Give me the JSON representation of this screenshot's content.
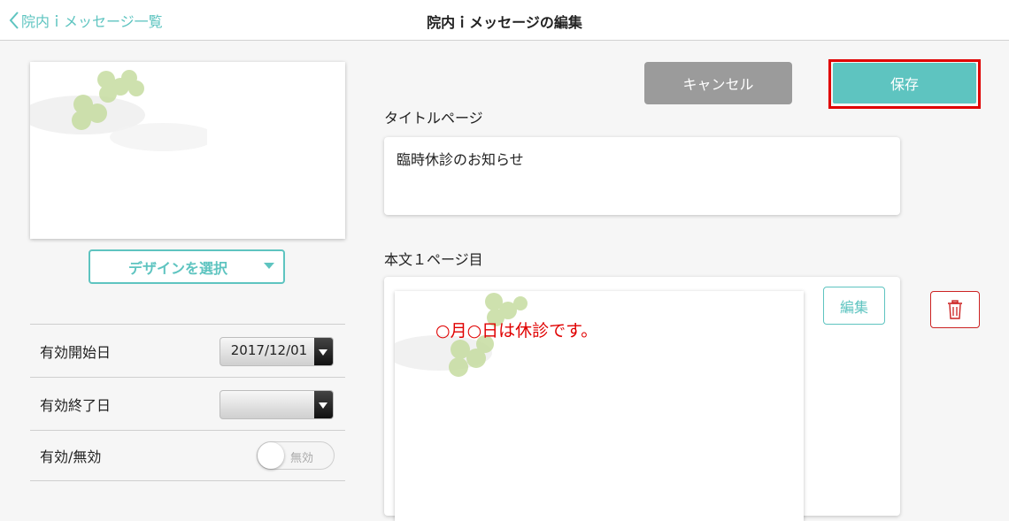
{
  "header": {
    "back_label": "院内ｉメッセージ一覧",
    "title": "院内ｉメッセージの編集"
  },
  "left": {
    "design_button_label": "デザインを選択",
    "rows": [
      {
        "label": "有効開始日",
        "value": "2017/12/01"
      },
      {
        "label": "有効終了日",
        "value": ""
      },
      {
        "label": "有効/無効",
        "toggle_label": "無効"
      }
    ]
  },
  "actions": {
    "cancel_label": "キャンセル",
    "save_label": "保存"
  },
  "title_section": {
    "label": "タイトルページ",
    "value": "臨時休診のお知らせ"
  },
  "body_section": {
    "label": "本文１ページ目",
    "page_text": "○月○日は休診です。",
    "edit_label": "編集"
  },
  "colors": {
    "accent": "#5ec4c0",
    "cancel": "#9b9b9b",
    "highlight": "#e00000"
  }
}
